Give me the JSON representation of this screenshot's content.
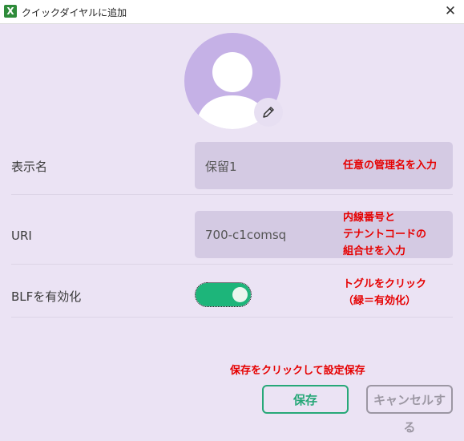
{
  "window": {
    "title": "クイックダイヤルに追加",
    "app_icon_letter": "X"
  },
  "form": {
    "display_name": {
      "label": "表示名",
      "value": "保留1"
    },
    "uri": {
      "label": "URI",
      "value": "700-c1comsq"
    },
    "blf": {
      "label": "BLFを有効化",
      "enabled": true
    }
  },
  "annotations": {
    "display_name": "任意の管理名を入力",
    "uri_lines": [
      "内線番号と",
      "テナントコードの",
      "組合せを入力"
    ],
    "toggle_lines": [
      "トグルをクリック",
      "（緑＝有効化）"
    ],
    "save": "保存をクリックして設定保存"
  },
  "buttons": {
    "save": "保存",
    "cancel": "キャンセルする"
  },
  "colors": {
    "background": "#ebe3f4",
    "field": "#d4cae3",
    "accent": "#27a878",
    "toggle_on": "#1db57a",
    "annotation": "#e60000"
  }
}
